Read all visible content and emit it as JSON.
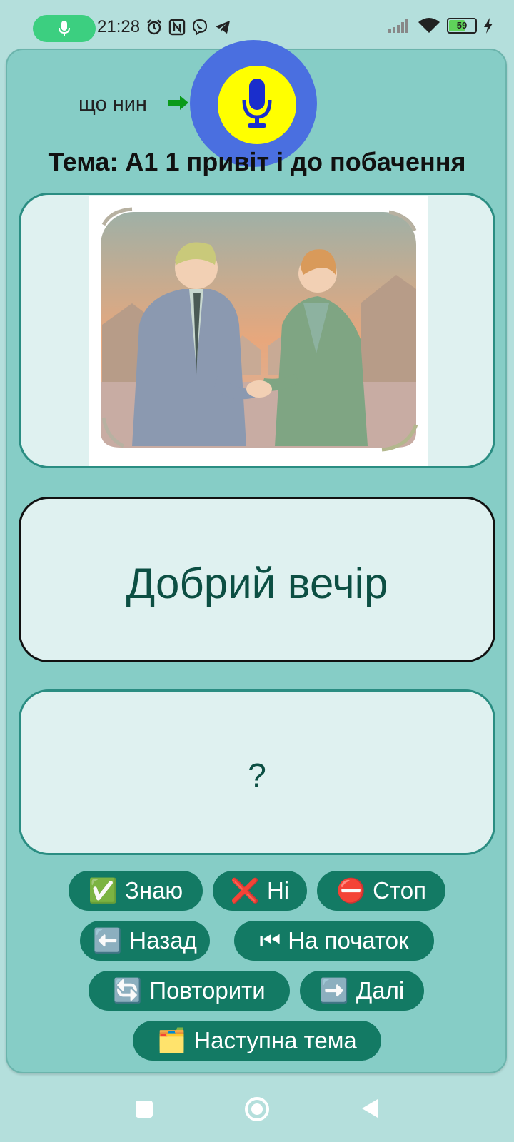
{
  "status_bar": {
    "time": "21:28",
    "battery": "59",
    "icons": [
      "microphone-icon",
      "alarm-icon",
      "nfc-icon",
      "viber-icon",
      "telegram-icon",
      "signal-icon",
      "wifi-icon",
      "battery-icon",
      "charging-icon"
    ]
  },
  "header": {
    "hint": "що нин",
    "mic_button_icon": "microphone-icon",
    "topic": "Тема: А1 1 привіт і до побачення"
  },
  "card": {
    "image_alt": "two people shaking hands",
    "word": "Добрий вечір",
    "answer": "?"
  },
  "buttons": {
    "know": {
      "icon": "✅",
      "label": "Знаю"
    },
    "no": {
      "icon": "❌",
      "label": "Ні"
    },
    "stop": {
      "icon": "⛔",
      "label": "Стоп"
    },
    "back": {
      "icon": "⬅️",
      "label": "Назад"
    },
    "start": {
      "icon": "⏮",
      "label": "На початок"
    },
    "repeat": {
      "icon": "🔄",
      "label": "Повторити"
    },
    "next": {
      "icon": "➡️",
      "label": "Далі"
    },
    "next_topic": {
      "icon": "🗂️",
      "label": "Наступна тема"
    }
  },
  "colors": {
    "background": "#b4dfdc",
    "panel": "#86cdc6",
    "button": "#137a64",
    "mic_halo": "#4a6fe0",
    "mic_button": "#ffff00",
    "word_text": "#0c4f43"
  }
}
